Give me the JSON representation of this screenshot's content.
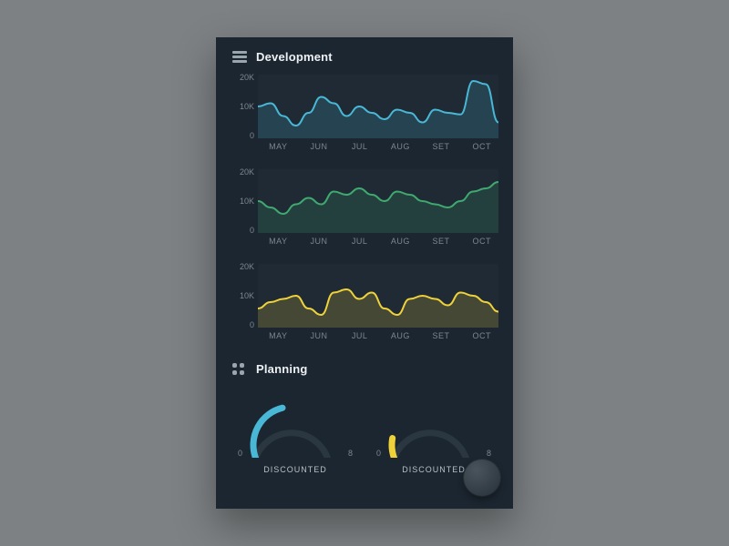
{
  "sections": {
    "development": {
      "title": "Development"
    },
    "planning": {
      "title": "Planning"
    }
  },
  "axis": {
    "yticks": [
      "20K",
      "10K",
      "0"
    ],
    "months": [
      "MAY",
      "JUN",
      "JUL",
      "AUG",
      "SET",
      "OCT"
    ]
  },
  "gauges": [
    {
      "label": "DISCOUNTED",
      "min": "0",
      "max": "8",
      "value": 3.5,
      "color": "#49b8d6"
    },
    {
      "label": "DISCOUNTED",
      "min": "0",
      "max": "8",
      "value": 1.1,
      "color": "#efd23a"
    }
  ],
  "colors": {
    "blue": "#49b8d6",
    "green": "#3fa96f",
    "yellow": "#efd23a",
    "panel": "#1c2630",
    "plot": "#1f2a34",
    "text_muted": "#7c8790"
  },
  "chart_data": [
    {
      "type": "area",
      "title": "",
      "color": "#49b8d6",
      "xlabel": "",
      "ylabel": "",
      "ylim": [
        0,
        20
      ],
      "x_ticks": [
        "MAY",
        "JUN",
        "JUL",
        "AUG",
        "SET",
        "OCT"
      ],
      "y_ticks": [
        0,
        10,
        20
      ],
      "x": [
        0,
        1,
        2,
        3,
        4,
        5,
        6,
        7,
        8,
        9,
        10,
        11,
        12,
        13,
        14,
        15,
        16,
        17,
        18,
        19
      ],
      "values": [
        10,
        11,
        7,
        4,
        8,
        13,
        11,
        7,
        10,
        8,
        6,
        9,
        8,
        5,
        9,
        8,
        7.5,
        18,
        17,
        5
      ]
    },
    {
      "type": "area",
      "title": "",
      "color": "#3fa96f",
      "xlabel": "",
      "ylabel": "",
      "ylim": [
        0,
        20
      ],
      "x_ticks": [
        "MAY",
        "JUN",
        "JUL",
        "AUG",
        "SET",
        "OCT"
      ],
      "y_ticks": [
        0,
        10,
        20
      ],
      "x": [
        0,
        1,
        2,
        3,
        4,
        5,
        6,
        7,
        8,
        9,
        10,
        11,
        12,
        13,
        14,
        15,
        16,
        17,
        18,
        19
      ],
      "values": [
        10,
        8,
        6,
        9,
        11,
        9,
        13,
        12,
        14,
        12,
        10,
        13,
        12,
        10,
        9,
        8,
        10,
        13,
        14,
        16
      ]
    },
    {
      "type": "area",
      "title": "",
      "color": "#efd23a",
      "xlabel": "",
      "ylabel": "",
      "ylim": [
        0,
        20
      ],
      "x_ticks": [
        "MAY",
        "JUN",
        "JUL",
        "AUG",
        "SET",
        "OCT"
      ],
      "y_ticks": [
        0,
        10,
        20
      ],
      "x": [
        0,
        1,
        2,
        3,
        4,
        5,
        6,
        7,
        8,
        9,
        10,
        11,
        12,
        13,
        14,
        15,
        16,
        17,
        18,
        19
      ],
      "values": [
        6,
        8,
        9,
        10,
        6,
        4,
        11,
        12,
        9,
        11,
        6,
        4,
        9,
        10,
        9,
        7,
        11,
        10,
        8,
        5
      ]
    }
  ]
}
